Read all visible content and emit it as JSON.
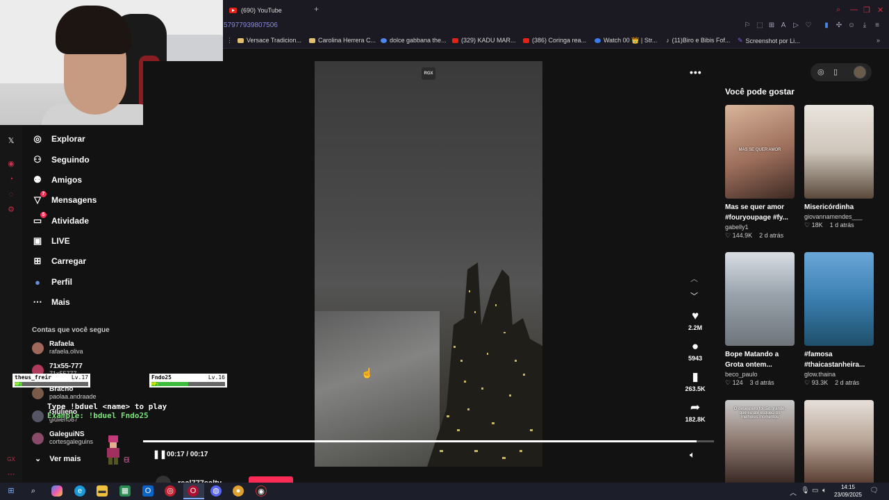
{
  "browser": {
    "tab_title": "(690) YouTube",
    "new_tab": "+",
    "url_fragment": "57977939807506",
    "bookmarks": [
      {
        "label": "Versace Tradicion...",
        "color": "#e3c170"
      },
      {
        "label": "Carolina Herrera C...",
        "color": "#e3c170"
      },
      {
        "label": "dolce gabbana the...",
        "color": "#4f86ec"
      },
      {
        "label": "(329) KADU MAR...",
        "color": "#e62117"
      },
      {
        "label": "(386) Coringa rea...",
        "color": "#e62117"
      },
      {
        "label": "Watch 00 👑 | Str...",
        "color": "#3b7cf0"
      },
      {
        "label": "(11)Biro e Bibis Fof...",
        "color": "#111111"
      },
      {
        "label": "Screenshot por Li...",
        "color": "#8a5cf6"
      }
    ],
    "accent_color": "#d03040"
  },
  "sidebar": {
    "nav": [
      {
        "label": "Explorar",
        "icon": "compass-icon",
        "glyph": "◎"
      },
      {
        "label": "Seguindo",
        "icon": "user-follow-icon",
        "glyph": "⚇"
      },
      {
        "label": "Amigos",
        "icon": "friends-icon",
        "glyph": "⚉"
      },
      {
        "label": "Mensagens",
        "icon": "paper-plane-icon",
        "glyph": "▽",
        "badge": "7"
      },
      {
        "label": "Atividade",
        "icon": "inbox-icon",
        "glyph": "▭",
        "badge": "5"
      },
      {
        "label": "LIVE",
        "icon": "live-tv-icon",
        "glyph": "▣"
      },
      {
        "label": "Carregar",
        "icon": "upload-plus-icon",
        "glyph": "⊞"
      },
      {
        "label": "Perfil",
        "icon": "avatar-icon",
        "glyph": "●"
      },
      {
        "label": "Mais",
        "icon": "more-dots-icon",
        "glyph": "⋯"
      }
    ],
    "following_heading": "Contas que você segue",
    "accounts": [
      {
        "name": "Rafaela",
        "user": "rafaela.oliva"
      },
      {
        "name": "71x55-777",
        "user": "71x55777"
      },
      {
        "name": "Bracho",
        "user": "paolaa.andraade"
      },
      {
        "name": "Giulieno",
        "user": "giulieno87"
      },
      {
        "name": "GaleguiNS",
        "user": "cortesgaleguins"
      }
    ],
    "see_more": "Ver mais"
  },
  "overlay": {
    "player1": {
      "name": "theus_freir",
      "level": "Lv.17",
      "hp_label": "HP:",
      "hp_fraction": 0.0
    },
    "player2": {
      "name": "Fndo25",
      "level": "Lv.16",
      "hp_label": "HP:",
      "hp_fraction": 0.5
    },
    "command": "Type !bduel <name> to play",
    "example": "Example: !bduel Fndo25"
  },
  "video": {
    "watermark": "RGX",
    "more": "•••",
    "likes": "2.2M",
    "comments": "5943",
    "saves": "263.5K",
    "shares": "182.8K",
    "time": "00:17 / 00:17",
    "progress_fraction": 0.97,
    "next_author": "real777salty"
  },
  "recommendations": {
    "heading": "Você pode gostar",
    "items": [
      {
        "caption1": "Mas se quer amor",
        "caption2": "#fouryoupage #fy...",
        "author": "gabelly1",
        "likes": "144.9K",
        "age": "2 d atrás",
        "thumb_text": "MAS SE QUER AMOR"
      },
      {
        "caption1": "Misericórdinha",
        "caption2": "",
        "author": "giovannamendes___",
        "likes": "18K",
        "age": "1 d atrás",
        "thumb_text": ""
      },
      {
        "caption1": "Bope Matando a",
        "caption2": "Grota ontem...",
        "author": "beco_paulo",
        "likes": "124",
        "age": "3 d atrás",
        "thumb_text": ""
      },
      {
        "caption1": "#famosa",
        "caption2": "#thaicastanheira...",
        "author": "glow.thaina",
        "likes": "93.3K",
        "age": "2 d atrás",
        "thumb_text": ""
      },
      {
        "caption1": "",
        "caption2": "",
        "author": "",
        "likes": "",
        "age": "",
        "thumb_text": "O desespero foi tão grande, que eu até esqueci os melhores momentos"
      },
      {
        "caption1": "",
        "caption2": "",
        "author": "",
        "likes": "",
        "age": "",
        "thumb_text": ""
      }
    ]
  },
  "taskbar": {
    "time": "14:15",
    "date": "23/09/2025"
  }
}
